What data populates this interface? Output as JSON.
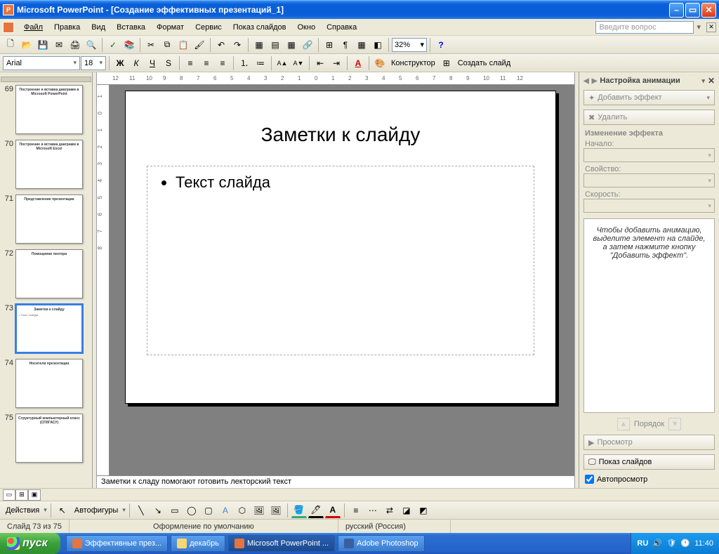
{
  "app": {
    "title": "Microsoft PowerPoint - [Создание эффективных презентаций_1]"
  },
  "menu": {
    "file": "Файл",
    "edit": "Правка",
    "view": "Вид",
    "insert": "Вставка",
    "format": "Формат",
    "tools": "Сервис",
    "slideshow": "Показ слайдов",
    "window": "Окно",
    "help": "Справка",
    "help_placeholder": "Введите вопрос"
  },
  "toolbar": {
    "zoom": "32%"
  },
  "format": {
    "font_name": "Arial",
    "font_size": "18",
    "designer": "Конструктор",
    "new_slide": "Создать слайд"
  },
  "ruler_h": [
    "12",
    "11",
    "10",
    "9",
    "8",
    "7",
    "6",
    "5",
    "4",
    "3",
    "2",
    "1",
    "0",
    "1",
    "2",
    "3",
    "4",
    "5",
    "6",
    "7",
    "8",
    "9",
    "10",
    "11",
    "12"
  ],
  "ruler_v": [
    "1",
    "0",
    "1",
    "2",
    "3",
    "4",
    "5",
    "6",
    "7",
    "8"
  ],
  "thumbnails": [
    {
      "n": 69,
      "title": "Построение и вставка диаграмм в Microsoft PowerPoint",
      "body": ""
    },
    {
      "n": 70,
      "title": "Построение и вставка диаграмм в Microsoft Excel",
      "body": ""
    },
    {
      "n": 71,
      "title": "Представление презентации",
      "body": ""
    },
    {
      "n": 72,
      "title": "Помощники лектора",
      "body": ""
    },
    {
      "n": 73,
      "title": "Заметки к слайду",
      "body": "• Текст слайда",
      "selected": true
    },
    {
      "n": 74,
      "title": "Носители презентации",
      "body": ""
    },
    {
      "n": 75,
      "title": "Структурный компьютерный класс (СПбГАСУ)",
      "body": ""
    }
  ],
  "slide": {
    "title": "Заметки к слайду",
    "bullet1": "Текст слайда"
  },
  "notes": "Заметки к сладу помогают готовить лекторский текст",
  "taskpane": {
    "title": "Настройка анимации",
    "add_effect": "Добавить эффект",
    "delete": "Удалить",
    "change_effect": "Изменение эффекта",
    "start": "Начало:",
    "property": "Свойство:",
    "speed": "Скорость:",
    "hint": "Чтобы добавить анимацию, выделите элемент на слайде, а затем нажмите кнопку \"Добавить эффект\".",
    "order": "Порядок",
    "preview": "Просмотр",
    "slideshow": "Показ слайдов",
    "autopreview": "Автопросмотр"
  },
  "drawing": {
    "actions": "Действия",
    "autoshapes": "Автофигуры"
  },
  "status": {
    "slide": "Слайд 73 из 75",
    "design": "Оформление по умолчанию",
    "lang": "русский (Россия)"
  },
  "taskbar": {
    "start": "пуск",
    "items": [
      {
        "label": "Эффективные през...",
        "kind": "pp"
      },
      {
        "label": "декабрь",
        "kind": "fd"
      },
      {
        "label": "Microsoft PowerPoint ...",
        "kind": "pp",
        "active": true
      },
      {
        "label": "Adobe Photoshop",
        "kind": "ps"
      }
    ],
    "lang": "RU",
    "time": "11:40"
  }
}
